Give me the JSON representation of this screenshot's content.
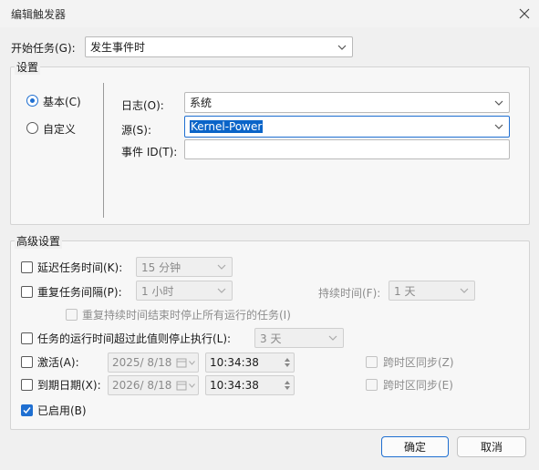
{
  "dialog": {
    "title": "编辑触发器"
  },
  "begin_task": {
    "label": "开始任务(G):",
    "value": "发生事件时"
  },
  "settings": {
    "group_label": "设置",
    "radio_basic": "基本(C)",
    "radio_custom": "自定义",
    "log_label": "日志(O):",
    "log_value": "系统",
    "source_label": "源(S):",
    "source_value": "Kernel-Power",
    "event_id_label": "事件 ID(T):",
    "event_id_value": ""
  },
  "advanced": {
    "group_label": "高级设置",
    "delay_label": "延迟任务时间(K):",
    "delay_value": "15 分钟",
    "repeat_label": "重复任务间隔(P):",
    "repeat_value": "1 小时",
    "duration_label": "持续时间(F):",
    "duration_value": "1 天",
    "stop_all_label": "重复持续时间结束时停止所有运行的任务(I)",
    "stop_if_label": "任务的运行时间超过此值则停止执行(L):",
    "stop_if_value": "3 天",
    "activate_label": "激活(A):",
    "activate_date": "2025/  8/18",
    "activate_time": "10:34:38",
    "activate_sync_label": "跨时区同步(Z)",
    "expire_label": "到期日期(X):",
    "expire_date": "2026/  8/18",
    "expire_time": "10:34:38",
    "expire_sync_label": "跨时区同步(E)",
    "enabled_label": "已启用(B)"
  },
  "buttons": {
    "ok": "确定",
    "cancel": "取消"
  },
  "colors": {
    "accent": "#1f6fd1"
  }
}
